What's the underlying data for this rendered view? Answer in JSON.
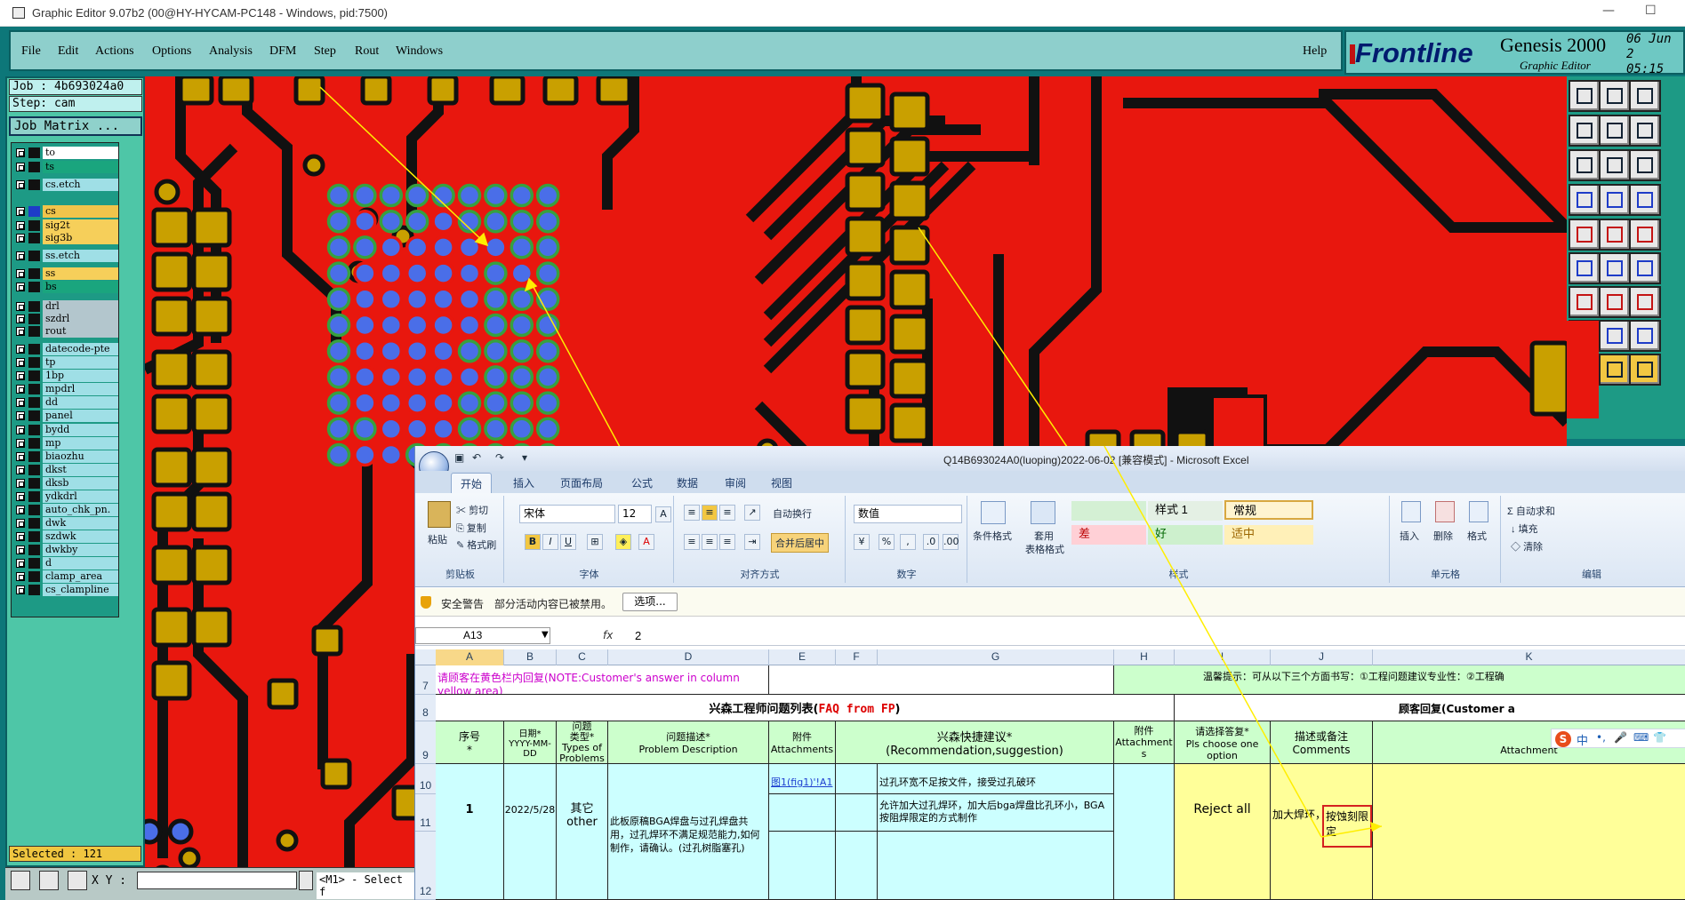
{
  "window": {
    "title": "Graphic Editor 9.07b2 (00@HY-HYCAM-PC148 - Windows, pid:7500)"
  },
  "menu": {
    "items": [
      "File",
      "Edit",
      "Actions",
      "Options",
      "Analysis",
      "DFM",
      "Step",
      "Rout",
      "Windows"
    ],
    "help": "Help"
  },
  "brand": {
    "logo": "Frontline",
    "product": "Genesis 2000",
    "subtitle": "Graphic Editor",
    "date": "06 Jun 2",
    "time": "05:15 "
  },
  "job": {
    "job": "Job : 4b693024a0",
    "step": "Step: cam",
    "matrix": "Job Matrix ..."
  },
  "layers": [
    {
      "name": "to",
      "color": "#ffffff"
    },
    {
      "name": "ts",
      "color": "#1aa57e"
    },
    {
      "name": "cs.etch",
      "color": "#9fdfe6"
    },
    {
      "name": "cs",
      "color": "#f0c44b"
    },
    {
      "name": "sig2t",
      "color": "#f6cf5a"
    },
    {
      "name": "sig3b",
      "color": "#f6cf5a"
    },
    {
      "name": "ss.etch",
      "color": "#9fdfe6"
    },
    {
      "name": "ss",
      "color": "#f6cf5a"
    },
    {
      "name": "bs",
      "color": "#1aa57e"
    },
    {
      "name": "drl",
      "color": "#b3c6cd"
    },
    {
      "name": "szdrl",
      "color": "#b3c6cd"
    },
    {
      "name": "rout",
      "color": "#b3c6cd"
    },
    {
      "name": "datecode-pte",
      "color": "#9fdfe6"
    },
    {
      "name": "tp",
      "color": "#9fdfe6"
    },
    {
      "name": "1bp",
      "color": "#9fdfe6"
    },
    {
      "name": "mpdrl",
      "color": "#9fdfe6"
    },
    {
      "name": "dd",
      "color": "#9fdfe6"
    },
    {
      "name": "panel",
      "color": "#9fdfe6"
    },
    {
      "name": "bydd",
      "color": "#9fdfe6"
    },
    {
      "name": "mp",
      "color": "#9fdfe6"
    },
    {
      "name": "biaozhu",
      "color": "#9fdfe6"
    },
    {
      "name": "dkst",
      "color": "#9fdfe6"
    },
    {
      "name": "dksb",
      "color": "#9fdfe6"
    },
    {
      "name": "ydkdrl",
      "color": "#9fdfe6"
    },
    {
      "name": "auto_chk_pn.",
      "color": "#9fdfe6"
    },
    {
      "name": "dwk",
      "color": "#9fdfe6"
    },
    {
      "name": "szdwk",
      "color": "#9fdfe6"
    },
    {
      "name": "dwkby",
      "color": "#9fdfe6"
    },
    {
      "name": "d",
      "color": "#9fdfe6"
    },
    {
      "name": "clamp_area",
      "color": "#9fdfe6"
    },
    {
      "name": "cs_clampline",
      "color": "#9fdfe6"
    }
  ],
  "status": {
    "selected": "Selected : 121",
    "xy": "X Y :",
    "message": "<M1> - Select f"
  },
  "excel": {
    "title": "Q14B693024A0(luoping)2022-06-02  [兼容模式] - Microsoft Excel",
    "tabs": [
      "开始",
      "插入",
      "页面布局",
      "公式",
      "数据",
      "审阅",
      "视图"
    ],
    "clipboard": {
      "paste": "粘贴",
      "cut": "剪切",
      "copy": "复制",
      "format_painter": "格式刷",
      "label": "剪贴板"
    },
    "font": {
      "name": "宋体",
      "size": "12",
      "label": "字体"
    },
    "alignment": {
      "wrap": "自动换行",
      "merge": "合并后居中",
      "label": "对齐方式"
    },
    "number": {
      "format": "数值",
      "label": "数字"
    },
    "styles": {
      "cond": "条件格式",
      "table": "套用",
      "table2": "表格格式",
      "style1": "样式 1",
      "normal": "常规",
      "bad": "差",
      "good": "好",
      "neutral": "适中",
      "label": "样式"
    },
    "cells": {
      "insert": "插入",
      "delete": "删除",
      "format": "格式",
      "label": "单元格"
    },
    "editing": {
      "autosum": "Σ 自动求和",
      "fill": "填充",
      "clear": "清除",
      "label": "编辑"
    },
    "security": {
      "title": "安全警告",
      "text": "部分活动内容已被禁用。",
      "button": "选项..."
    },
    "namebox": "A13",
    "formula_value": "2",
    "columns": [
      "A",
      "B",
      "C",
      "D",
      "E",
      "F",
      "G",
      "H",
      "I",
      "J",
      "K"
    ],
    "rows": [
      "7",
      "8",
      "9",
      "10",
      "11",
      "12"
    ],
    "r7_note": "请顾客在黄色栏内回复(NOTE:Customer's answer in column yellow area)",
    "r7_tip": "温馨提示：可从以下三个方面书写：①工程问题建议专业性：②工程确",
    "r8_title": "兴森工程师问题列表(",
    "r8_faq": "FAQ from FP",
    "r8_close": ")",
    "r8_cust": "顾客回复(Customer a",
    "h": {
      "a1": "序号",
      "a2": "*",
      "b1": "日期*",
      "b2": "YYYY-MM-DD",
      "c1": "问题",
      "c2": "类型*",
      "c3": "Types of",
      "c4": "Problems",
      "d1": "问题描述*",
      "d2": "Problem Description",
      "e1": "附件",
      "e2": "Attachments",
      "g1": "兴森快捷建议*",
      "g2": "(Recommendation,suggestion)",
      "h1": "附件",
      "h2": "Attachment",
      "h3": "s",
      "i1": "请选择答复*",
      "i2": "Pls choose one option",
      "j1": "描述或备注",
      "j2": "Comments",
      "k1": "Attachment"
    },
    "r": {
      "seq": "1",
      "date": "2022/5/28",
      "type1": "其它",
      "type2": "other",
      "desc": "此板原稿BGA焊盘与过孔焊盘共用，过孔焊环不满足规范能力,如何制作，请确认。(过孔树脂塞孔)",
      "link": "图1(fig1)'!A1",
      "opt1": "过孔环宽不足按文件，接受过孔破环",
      "opt2": "允许加大过孔焊环，加大后bga焊盘比孔环小，BGA按阻焊限定的方式制作",
      "reply": "Reject all",
      "comment1": "加大焊环，",
      "comment2": "按蚀刻限定"
    },
    "ime": "中"
  }
}
